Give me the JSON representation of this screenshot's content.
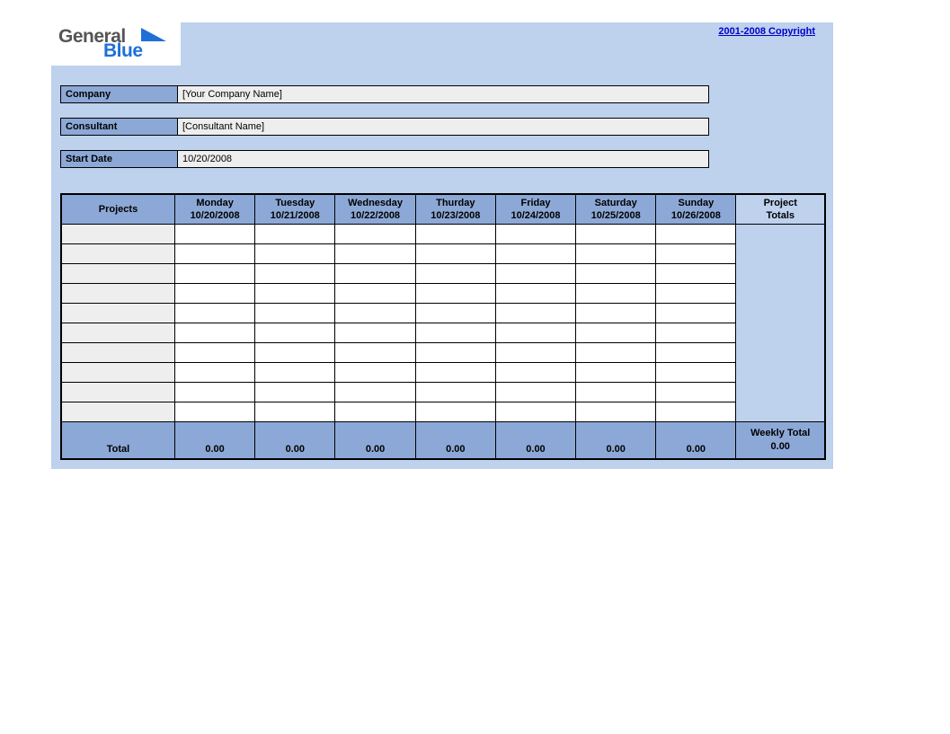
{
  "logo": {
    "word1": "General",
    "word2": "Blue"
  },
  "copyright": "2001-2008 Copyright",
  "fields": {
    "company_label": "Company",
    "company_value": "[Your Company Name]",
    "consultant_label": "Consultant",
    "consultant_value": "[Consultant Name]",
    "startdate_label": "Start Date",
    "startdate_value": "10/20/2008"
  },
  "table": {
    "projects_header": "Projects",
    "totals_header": "Project\nTotals",
    "days": [
      {
        "name": "Monday",
        "date": "10/20/2008"
      },
      {
        "name": "Tuesday",
        "date": "10/21/2008"
      },
      {
        "name": "Wednesday",
        "date": "10/22/2008"
      },
      {
        "name": "Thurday",
        "date": "10/23/2008"
      },
      {
        "name": "Friday",
        "date": "10/24/2008"
      },
      {
        "name": "Saturday",
        "date": "10/25/2008"
      },
      {
        "name": "Sunday",
        "date": "10/26/2008"
      }
    ],
    "rows": [
      {
        "project": "",
        "hours": [
          "",
          "",
          "",
          "",
          "",
          "",
          ""
        ]
      },
      {
        "project": "",
        "hours": [
          "",
          "",
          "",
          "",
          "",
          "",
          ""
        ]
      },
      {
        "project": "",
        "hours": [
          "",
          "",
          "",
          "",
          "",
          "",
          ""
        ]
      },
      {
        "project": "",
        "hours": [
          "",
          "",
          "",
          "",
          "",
          "",
          ""
        ]
      },
      {
        "project": "",
        "hours": [
          "",
          "",
          "",
          "",
          "",
          "",
          ""
        ]
      },
      {
        "project": "",
        "hours": [
          "",
          "",
          "",
          "",
          "",
          "",
          ""
        ]
      },
      {
        "project": "",
        "hours": [
          "",
          "",
          "",
          "",
          "",
          "",
          ""
        ]
      },
      {
        "project": "",
        "hours": [
          "",
          "",
          "",
          "",
          "",
          "",
          ""
        ]
      },
      {
        "project": "",
        "hours": [
          "",
          "",
          "",
          "",
          "",
          "",
          ""
        ]
      },
      {
        "project": "",
        "hours": [
          "",
          "",
          "",
          "",
          "",
          "",
          ""
        ]
      }
    ],
    "total_label": "Total",
    "day_totals": [
      "0.00",
      "0.00",
      "0.00",
      "0.00",
      "0.00",
      "0.00",
      "0.00"
    ],
    "weekly_total_label": "Weekly Total",
    "weekly_total_value": "0.00"
  }
}
